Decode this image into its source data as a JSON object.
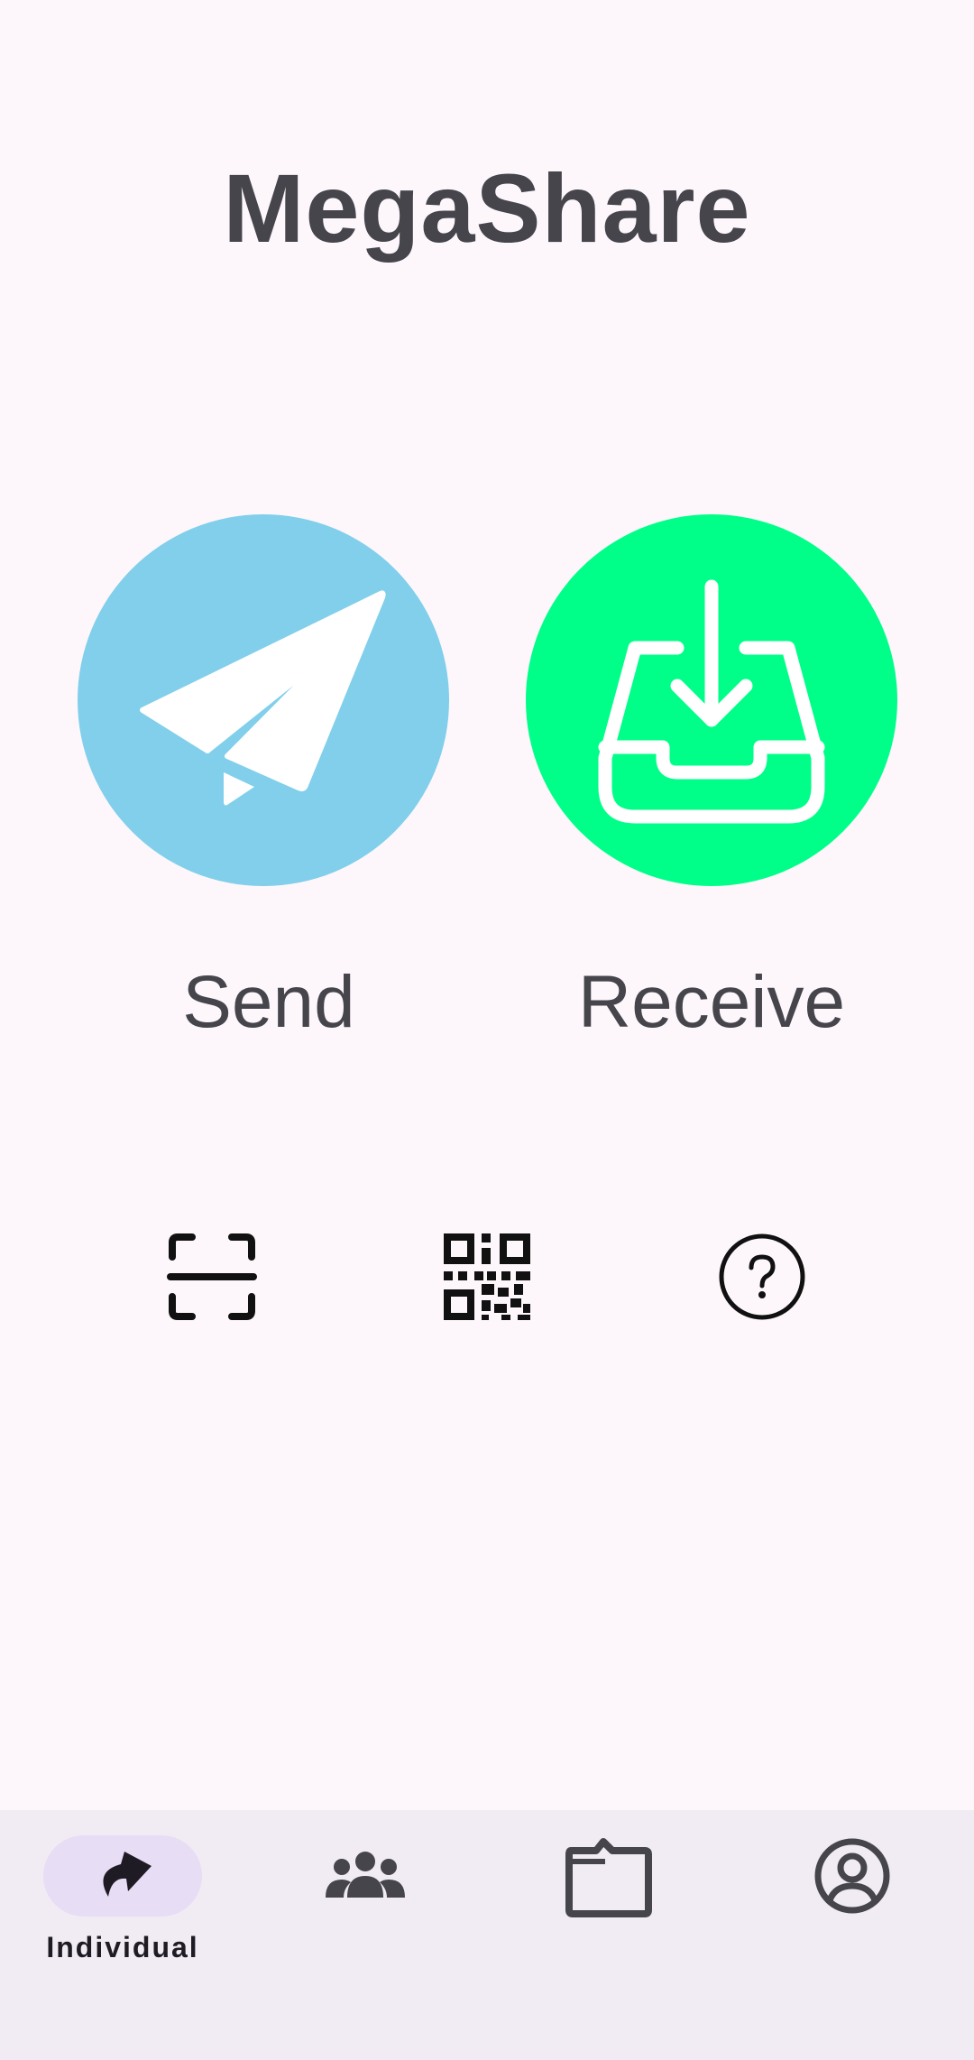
{
  "app": {
    "title": "MegaShare"
  },
  "actions": {
    "send": {
      "label": "Send",
      "color": "#81cfeb",
      "icon": "paper-plane-icon"
    },
    "receive": {
      "label": "Receive",
      "color": "#00ff88",
      "icon": "inbox-download-icon"
    }
  },
  "tools": [
    {
      "icon": "scan-icon"
    },
    {
      "icon": "qr-code-icon"
    },
    {
      "icon": "help-icon"
    }
  ],
  "bottom_nav": {
    "items": [
      {
        "label": "Individual",
        "icon": "share-arrow-icon",
        "active": true
      },
      {
        "label": "",
        "icon": "group-icon",
        "active": false
      },
      {
        "label": "",
        "icon": "folder-icon",
        "active": false
      },
      {
        "label": "",
        "icon": "account-icon",
        "active": false
      }
    ]
  },
  "colors": {
    "background": "#fdf7fc",
    "text": "#46454c",
    "nav_background": "#f1ecf4",
    "nav_active_pill": "#e7ddf5"
  }
}
